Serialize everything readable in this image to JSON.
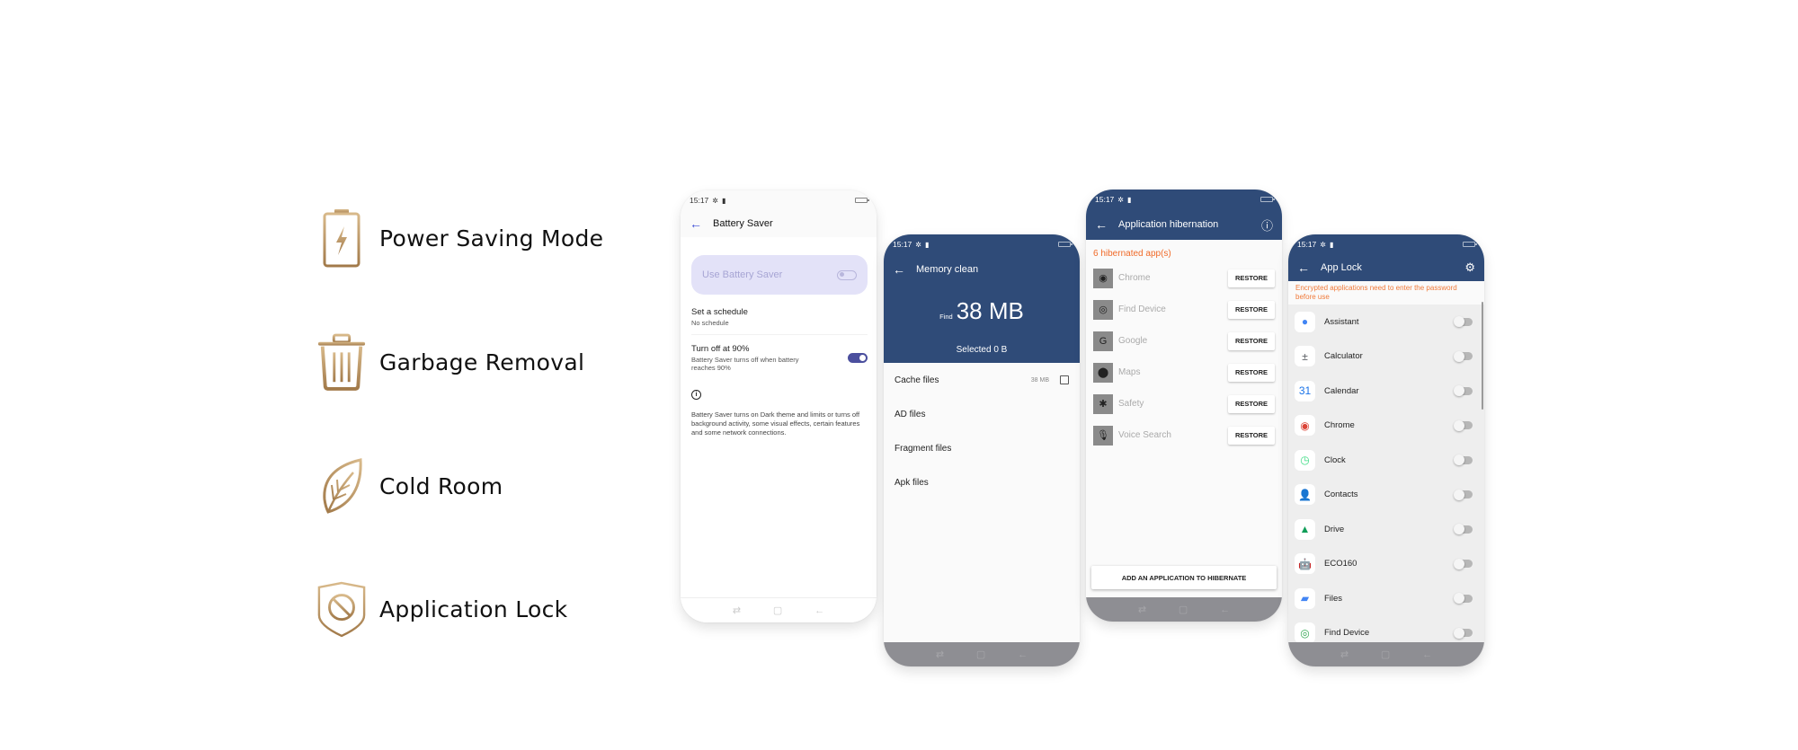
{
  "features": [
    {
      "icon": "battery-bolt-icon",
      "label": "Power Saving Mode"
    },
    {
      "icon": "trash-icon",
      "label": "Garbage Removal"
    },
    {
      "icon": "leaf-icon",
      "label": "Cold Room"
    },
    {
      "icon": "shield-block-icon",
      "label": "Application Lock"
    }
  ],
  "colors": {
    "gold": "#b08a58",
    "header_blue": "#2f4b78",
    "orange": "#f06a28",
    "accent_purple": "#4b4f9e"
  },
  "status": {
    "time": "15:17"
  },
  "battery_saver": {
    "title": "Battery Saver",
    "use_label": "Use Battery Saver",
    "use_enabled": false,
    "schedule_title": "Set a schedule",
    "schedule_value": "No schedule",
    "turnoff_title": "Turn off at 90%",
    "turnoff_desc": "Battery Saver turns off when battery reaches 90%",
    "turnoff_enabled": true,
    "info_text": "Battery Saver turns on Dark theme and limits or turns off background activity, some visual effects, certain features and some network connections."
  },
  "memory_clean": {
    "title": "Memory clean",
    "find_label": "Find",
    "find_value": "38 MB",
    "selected": "Selected 0 B",
    "items": [
      {
        "label": "Cache files",
        "size": "38 MB",
        "checkbox": true
      },
      {
        "label": "AD files"
      },
      {
        "label": "Fragment files"
      },
      {
        "label": "Apk files"
      }
    ]
  },
  "hibernation": {
    "title": "Application hibernation",
    "count": "6 hibernated app(s)",
    "restore_label": "RESTORE",
    "apps": [
      {
        "name": "Chrome",
        "glyph": "◉"
      },
      {
        "name": "Find Device",
        "glyph": "◎"
      },
      {
        "name": "Google",
        "glyph": "G"
      },
      {
        "name": "Maps",
        "glyph": "⬤"
      },
      {
        "name": "Safety",
        "glyph": "✱"
      },
      {
        "name": "Voice Search",
        "glyph": "🎙"
      }
    ],
    "add_button": "ADD AN APPLICATION TO HIBERNATE"
  },
  "app_lock": {
    "title": "App Lock",
    "warning": "Encrypted applications need to enter the password before use",
    "apps": [
      {
        "name": "Assistant",
        "glyph": "●",
        "color": "#4285f4"
      },
      {
        "name": "Calculator",
        "glyph": "±",
        "color": "#5f6368"
      },
      {
        "name": "Calendar",
        "glyph": "31",
        "color": "#1a73e8"
      },
      {
        "name": "Chrome",
        "glyph": "◉",
        "color": "#db4437"
      },
      {
        "name": "Clock",
        "glyph": "◷",
        "color": "#3ddc84"
      },
      {
        "name": "Contacts",
        "glyph": "👤",
        "color": "#1a73e8"
      },
      {
        "name": "Drive",
        "glyph": "▲",
        "color": "#0f9d58"
      },
      {
        "name": "ECO160",
        "glyph": "🤖",
        "color": "#3ddc84"
      },
      {
        "name": "Files",
        "glyph": "▰",
        "color": "#4285f4"
      },
      {
        "name": "Find Device",
        "glyph": "◎",
        "color": "#34a853"
      }
    ]
  }
}
